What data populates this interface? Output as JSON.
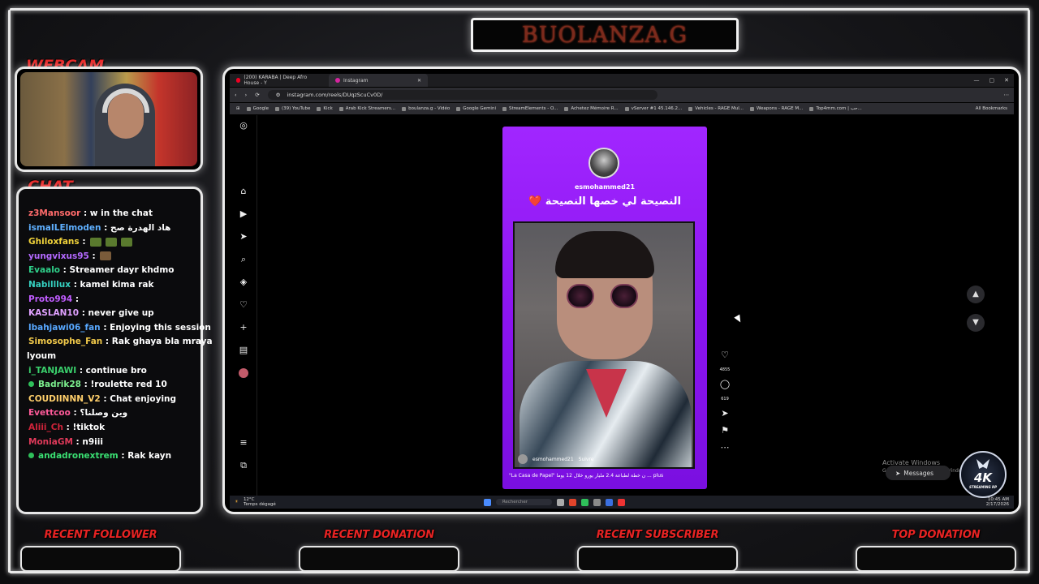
{
  "overlay": {
    "channel_name": "BUOLANZA.G",
    "webcam_label": "WEBCAM",
    "chat_label": "CHAT",
    "stats": [
      {
        "label": "RECENT FOLLOWER"
      },
      {
        "label": "RECENT DONATION"
      },
      {
        "label": "RECENT SUBSCRIBER"
      },
      {
        "label": "TOP DONATION"
      }
    ],
    "logo_text": "4K",
    "logo_sub": "STREAMING RP"
  },
  "chat": [
    {
      "user": "z3Mansoor",
      "msg": ": w in the chat",
      "color": "#ff6b6b"
    },
    {
      "user": "ismaILElmoden",
      "msg": ": هاد الهدرة صح",
      "color": "#5fb0ff"
    },
    {
      "user": "Ghiloxfans",
      "msg": ":",
      "color": "#f0d23a",
      "emotes": 3
    },
    {
      "user": "yungvixus95",
      "msg": ":",
      "color": "#b469ff",
      "emotes": 1
    },
    {
      "user": "Evaalo",
      "msg": ": Streamer dayr khdmo",
      "color": "#2fd08a"
    },
    {
      "user": "Nabilllux",
      "msg": ": kamel kima rak",
      "color": "#35d0c0"
    },
    {
      "user": "Proto994",
      "msg": ":",
      "color": "#c05cff"
    },
    {
      "user": "KASLAN10",
      "msg": ": never give up",
      "color": "#e0a1ff"
    },
    {
      "user": "lbahjawi06_fan",
      "msg": ": Enjoying this session",
      "color": "#58a8ff"
    },
    {
      "user": "Simosophe_Fan",
      "msg": ": Rak ghaya bla mraya",
      "color": "#f0c84a"
    },
    {
      "user": "",
      "msg": "lyoum",
      "color": "#ffffff"
    },
    {
      "user": "i_TANJAWI",
      "msg": ": continue bro",
      "color": "#3ad06c"
    },
    {
      "user": "Badrik28",
      "msg": ": !roulette red 10",
      "color": "#7cf08e",
      "badge": true
    },
    {
      "user": "COUDIINNN_V2",
      "msg": ": Chat enjoying",
      "color": "#ffcf6b"
    },
    {
      "user": "Evettcoo",
      "msg": ": وين وصلنا؟",
      "color": "#ff5b9a"
    },
    {
      "user": "Aliii_Ch",
      "msg": ": !tiktok",
      "color": "#d0243a"
    },
    {
      "user": "MoniaGM",
      "msg": ": n9iii",
      "color": "#e03a5a"
    },
    {
      "user": "andadronextrem",
      "msg": ": Rak kayn",
      "color": "#3adf72",
      "badge": true
    }
  ],
  "browser": {
    "tabs": [
      {
        "label": "(200) KARABA | Deep Afro House - Y"
      },
      {
        "label": "Instagram"
      }
    ],
    "url": "instagram.com/reels/DUqzScuCv0D/",
    "bookmarks": [
      "Google",
      "(39) YouTube",
      "Kick",
      "Arab Kick Streamers...",
      "boulanza.g - Vidéo",
      "Google Gemini",
      "StreamElements - O...",
      "Achetez Mémoire R...",
      "vServer #1 45.146.2...",
      "Vehicles - RAGE Mul...",
      "Weapons - RAGE M...",
      "Top4mm.com | حب..."
    ],
    "all_bookmarks": "All Bookmarks"
  },
  "reel": {
    "username": "esmohammed21",
    "title_text": "النصيحة لي خصها النصيحة",
    "title_emoji": "❤️",
    "caption_user": "esmohammed21",
    "follow": "Suivre",
    "caption": "\"La Casa de Papel\" ن خطة لطباعة 2.4 مليار يورو خلال 12 يوما ... plus",
    "likes": "4855",
    "comments": "619"
  },
  "desktop": {
    "activate_title": "Activate Windows",
    "activate_sub": "Go to Settings to activate Windows.",
    "messages": "Messages",
    "weather_temp": "12°C",
    "weather_desc": "Temps dégagé",
    "search_placeholder": "Rechercher",
    "time": "10:45 AM",
    "date": "2/17/2026"
  }
}
